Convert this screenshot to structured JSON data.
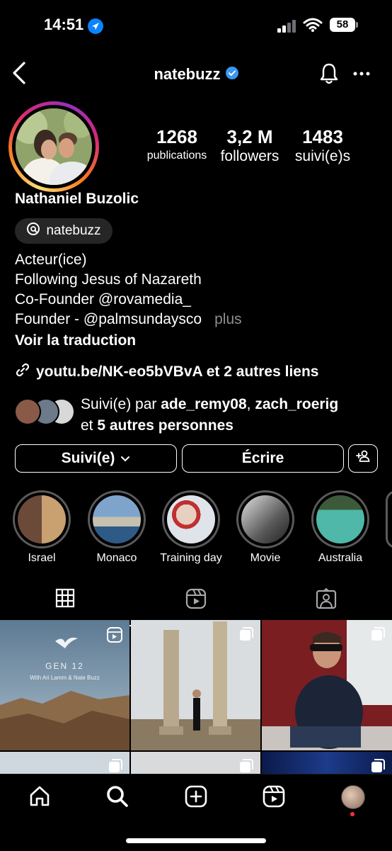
{
  "status_bar": {
    "time": "14:51",
    "battery": "58"
  },
  "header": {
    "username": "natebuzz"
  },
  "stats": [
    {
      "value": "1268",
      "label": "publications"
    },
    {
      "value": "3,2 M",
      "label": "followers"
    },
    {
      "value": "1483",
      "label": "suivi(e)s"
    }
  ],
  "profile": {
    "full_name": "Nathaniel Buzolic",
    "threads_handle": "natebuzz",
    "bio_lines": [
      "Acteur(ice)",
      "Following Jesus of Nazareth",
      "Co-Founder @rovamedia_",
      "Founder - @palmsundaysco"
    ],
    "bio_more": "plus",
    "translate": "Voir la traduction",
    "link": "youtu.be/NK-eo5bVBvA et 2 autres liens"
  },
  "mutual": {
    "prefix": "Suivi(e) par",
    "user1": "ade_remy08",
    "sep": ",",
    "user2": "zach_roerig",
    "and": "et",
    "others": "5 autres personnes"
  },
  "buttons": {
    "following": "Suivi(e)",
    "message": "Écrire"
  },
  "highlights": [
    "Israel",
    "Monaco",
    "Training day",
    "Movie",
    "Australia"
  ],
  "grid": {
    "post1_title": "GEN 12",
    "post1_subtitle": "With Ari Lamm & Nate Buzz"
  },
  "colors": {
    "verified": "#3897f0",
    "background": "#000000",
    "pill": "#262626",
    "notification_dot": "#ff3040"
  }
}
